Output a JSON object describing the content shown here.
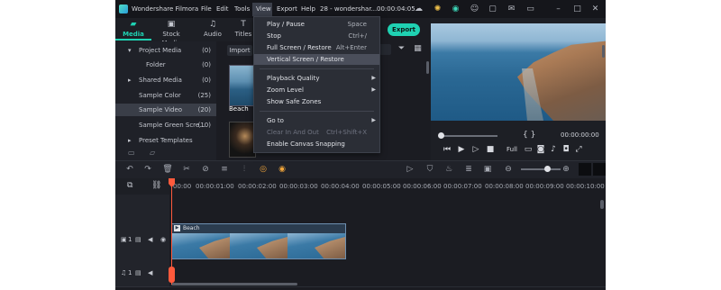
{
  "app": {
    "title": "Wondershare Filmora",
    "project": "28 - wondershar...",
    "duration": "00:00:04:05"
  },
  "menubar": [
    "File",
    "Edit",
    "Tools",
    "View",
    "Export",
    "Help"
  ],
  "media_tabs": [
    {
      "label": "Media",
      "icon": "folder-icon"
    },
    {
      "label": "Stock Media",
      "icon": "stock-icon"
    },
    {
      "label": "Audio",
      "icon": "music-icon"
    },
    {
      "label": "Titles",
      "icon": "text-icon"
    }
  ],
  "export_label": "Export",
  "import_label": "Import",
  "sidebar": [
    {
      "label": "Project Media",
      "count": "(0)",
      "arrow": "▾"
    },
    {
      "label": "Folder",
      "count": "(0)",
      "arrow": ""
    },
    {
      "label": "Shared Media",
      "count": "(0)",
      "arrow": "▸"
    },
    {
      "label": "Sample Color",
      "count": "(25)",
      "arrow": ""
    },
    {
      "label": "Sample Video",
      "count": "(20)",
      "arrow": ""
    },
    {
      "label": "Sample Green Scre...",
      "count": "(10)",
      "arrow": ""
    },
    {
      "label": "Preset Templates",
      "count": "",
      "arrow": "▸"
    }
  ],
  "media_items": [
    {
      "label": "Beach"
    }
  ],
  "view_menu": [
    {
      "label": "Play / Pause",
      "shortcut": "Space"
    },
    {
      "label": "Stop",
      "shortcut": "Ctrl+/"
    },
    {
      "label": "Full Screen / Restore",
      "shortcut": "Alt+Enter"
    },
    {
      "label": "Vertical Screen / Restore",
      "shortcut": ""
    },
    {
      "label": "Playback Quality",
      "shortcut": ""
    },
    {
      "label": "Zoom Level",
      "shortcut": ""
    },
    {
      "label": "Show Safe Zones",
      "shortcut": ""
    },
    {
      "label": "Go to",
      "shortcut": ""
    },
    {
      "label": "Clear In And Out",
      "shortcut": "Ctrl+Shift+X"
    },
    {
      "label": "Enable Canvas Snapping",
      "shortcut": ""
    }
  ],
  "preview": {
    "timecode": "00:00:00:00",
    "quality": "Full",
    "brackets": "{     }"
  },
  "ruler_ticks": [
    "00:00",
    "00:00:01:00",
    "00:00:02:00",
    "00:00:03:00",
    "00:00:04:00",
    "00:00:05:00",
    "00:00:06:00",
    "00:00:07:00",
    "00:00:08:00",
    "00:00:09:00",
    "00:00:10:00"
  ],
  "tracks": {
    "video_label": "1",
    "audio_label": "1",
    "clip_label": "Beach"
  },
  "colors": {
    "accent": "#1fd1b2",
    "playhead": "#ff5a3c",
    "menu_highlight": "#4a4e5a"
  }
}
